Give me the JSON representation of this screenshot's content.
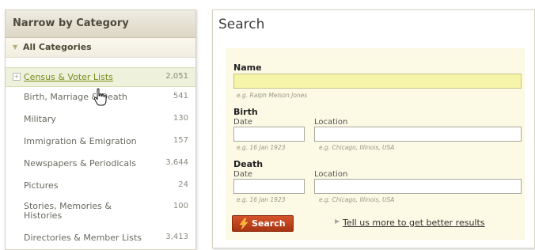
{
  "category_panel": {
    "title": "Narrow by Category",
    "all_label": "All Categories",
    "items": [
      {
        "label": "Census & Voter Lists",
        "count": "2,051"
      },
      {
        "label": "Birth, Marriage & Death",
        "count": "541"
      },
      {
        "label": "Military",
        "count": "130"
      },
      {
        "label": "Immigration & Emigration",
        "count": "157"
      },
      {
        "label": "Newspapers & Periodicals",
        "count": "3,644"
      },
      {
        "label": "Pictures",
        "count": "24"
      },
      {
        "label": "Stories, Memories & Histories",
        "count": "100"
      },
      {
        "label": "Directories & Member Lists",
        "count": "3,413"
      }
    ]
  },
  "search_panel": {
    "title": "Search",
    "name": {
      "label": "Name",
      "hint": "e.g. Ralph Melson Jones",
      "value": ""
    },
    "birth": {
      "label": "Birth",
      "date_label": "Date",
      "date_hint": "e.g. 16 Jan 1923",
      "location_label": "Location",
      "location_hint": "e.g. Chicago, Illinois, USA"
    },
    "death": {
      "label": "Death",
      "date_label": "Date",
      "date_hint": "e.g. 16 Jan 1923",
      "location_label": "Location",
      "location_hint": "e.g. Chicago, Illinois, USA"
    },
    "search_button": "Search",
    "more_link": "Tell us more to get better results"
  },
  "colors": {
    "accent_green": "#7a8c1c",
    "search_button": "#c0401c",
    "name_field_highlight": "#f5f4a8",
    "form_background": "#fcf9e4"
  }
}
